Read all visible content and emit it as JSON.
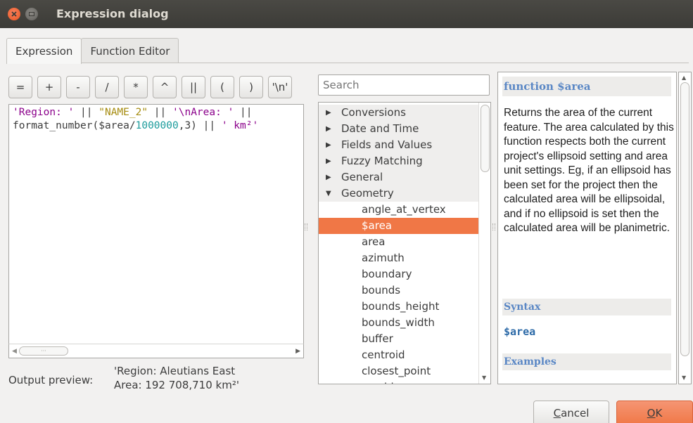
{
  "window": {
    "title": "Expression dialog"
  },
  "tabs": [
    {
      "label": "Expression",
      "active": true
    },
    {
      "label": "Function Editor",
      "active": false
    }
  ],
  "operators": [
    "=",
    "+",
    "-",
    "/",
    "*",
    "^",
    "||",
    "(",
    ")",
    "'\\n'"
  ],
  "editor": {
    "line1": {
      "s1": "'Region: '",
      "op1": " || ",
      "field": "\"NAME_2\"",
      "op2": " || ",
      "s2": "'\\nArea: '",
      "op3": " ||"
    },
    "line2": {
      "fn": "format_number($area/",
      "num": "1000000",
      "rest": ",3) || ",
      "s3": "' km²'"
    }
  },
  "preview": {
    "label": "Output preview:",
    "line1": "'Region: Aleutians East",
    "line2": "Area: 192 708,710 km²'"
  },
  "search": {
    "placeholder": "Search"
  },
  "function_tree": {
    "groups": [
      "Conversions",
      "Date and Time",
      "Fields and Values",
      "Fuzzy Matching",
      "General",
      "Geometry"
    ],
    "expanded_group": "Geometry",
    "geometry_items": [
      "angle_at_vertex",
      "$area",
      "area",
      "azimuth",
      "boundary",
      "bounds",
      "bounds_height",
      "bounds_width",
      "buffer",
      "centroid",
      "closest_point",
      "combine"
    ],
    "selected": "$area"
  },
  "help": {
    "title": "function $area",
    "description": "Returns the area of the current feature. The area calculated by this function respects both the current project's ellipsoid setting and area unit settings. Eg, if an ellipsoid has been set for the project then the calculated area will be ellipsoidal, and if no ellipsoid is set then the calculated area will be planimetric.",
    "syntax_header": "Syntax",
    "syntax": "$area",
    "examples_header": "Examples"
  },
  "buttons": {
    "cancel_prefix": "",
    "cancel_mnemonic": "C",
    "cancel_rest": "ancel",
    "ok_prefix": "",
    "ok_mnemonic": "O",
    "ok_rest": "K"
  },
  "colors": {
    "accent": "#f07746",
    "titlebar": "#3c3b37",
    "help_heading": "#5a87c5"
  }
}
